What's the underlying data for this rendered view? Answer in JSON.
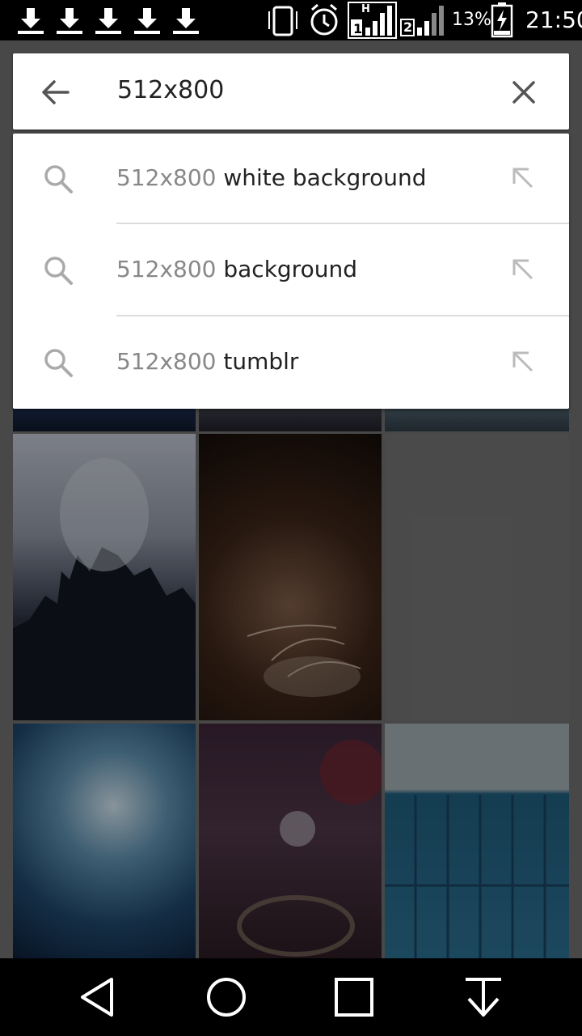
{
  "status_bar": {
    "battery_percent": "13%",
    "time": "21:50",
    "network_label": "H",
    "sim1_label": "1",
    "sim2_label": "2",
    "download_icons": [
      "download-icon",
      "download-icon",
      "download-icon",
      "download-icon",
      "download-icon"
    ]
  },
  "search": {
    "query": "512x800"
  },
  "suggestions": [
    {
      "prefix": "512x800",
      "rest": " white background"
    },
    {
      "prefix": "512x800",
      "rest": " background"
    },
    {
      "prefix": "512x800",
      "rest": " tumblr"
    }
  ],
  "nav_bar": {
    "icons": [
      "back-triangle-icon",
      "home-circle-icon",
      "recents-square-icon",
      "download-arrow-icon"
    ]
  }
}
